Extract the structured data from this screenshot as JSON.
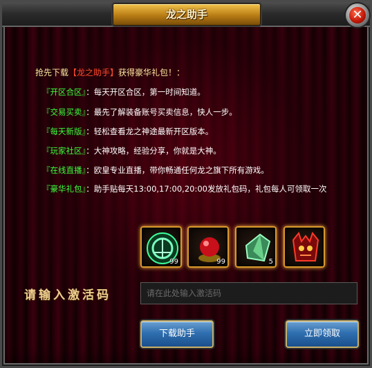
{
  "window": {
    "title": "龙之助手",
    "close_glyph": "✕"
  },
  "intro": {
    "prefix": "抢先下载",
    "highlight": "【龙之助手】",
    "suffix": "获得豪华礼包！："
  },
  "features": [
    {
      "tag": "『开区合区』",
      "desc": "：每天开区合区，第一时间知道。"
    },
    {
      "tag": "『交易买卖』",
      "desc": "：最先了解装备账号买卖信息，快人一步。"
    },
    {
      "tag": "『每天新版』",
      "desc": "：轻松查看龙之神途最新开区版本。"
    },
    {
      "tag": "『玩家社区』",
      "desc": "：大神攻略，经验分享，你就是大神。"
    },
    {
      "tag": "『在线直播』",
      "desc": "：欧皇专业直播，带你畅通任何龙之旗下所有游戏。"
    },
    {
      "tag": "『豪华礼包』",
      "desc": "：助手贴每天13:00,17:00,20:00发放礼包码，礼包每人可领取一次"
    }
  ],
  "rewards": [
    {
      "icon": "green-orb-icon",
      "count": "99"
    },
    {
      "icon": "red-pearl-icon",
      "count": "99"
    },
    {
      "icon": "jade-crystal-icon",
      "count": "5"
    },
    {
      "icon": "demon-mask-icon",
      "count": ""
    }
  ],
  "activation": {
    "label": "请输入激活码",
    "placeholder": "请在此处输入激活码"
  },
  "buttons": {
    "download": "下载助手",
    "claim": "立即领取"
  },
  "colors": {
    "feature_tag": "#3cff3c",
    "highlight": "#ff4a2a",
    "accent_border": "#d99a2c",
    "button_blue": "#2f6fb0"
  }
}
